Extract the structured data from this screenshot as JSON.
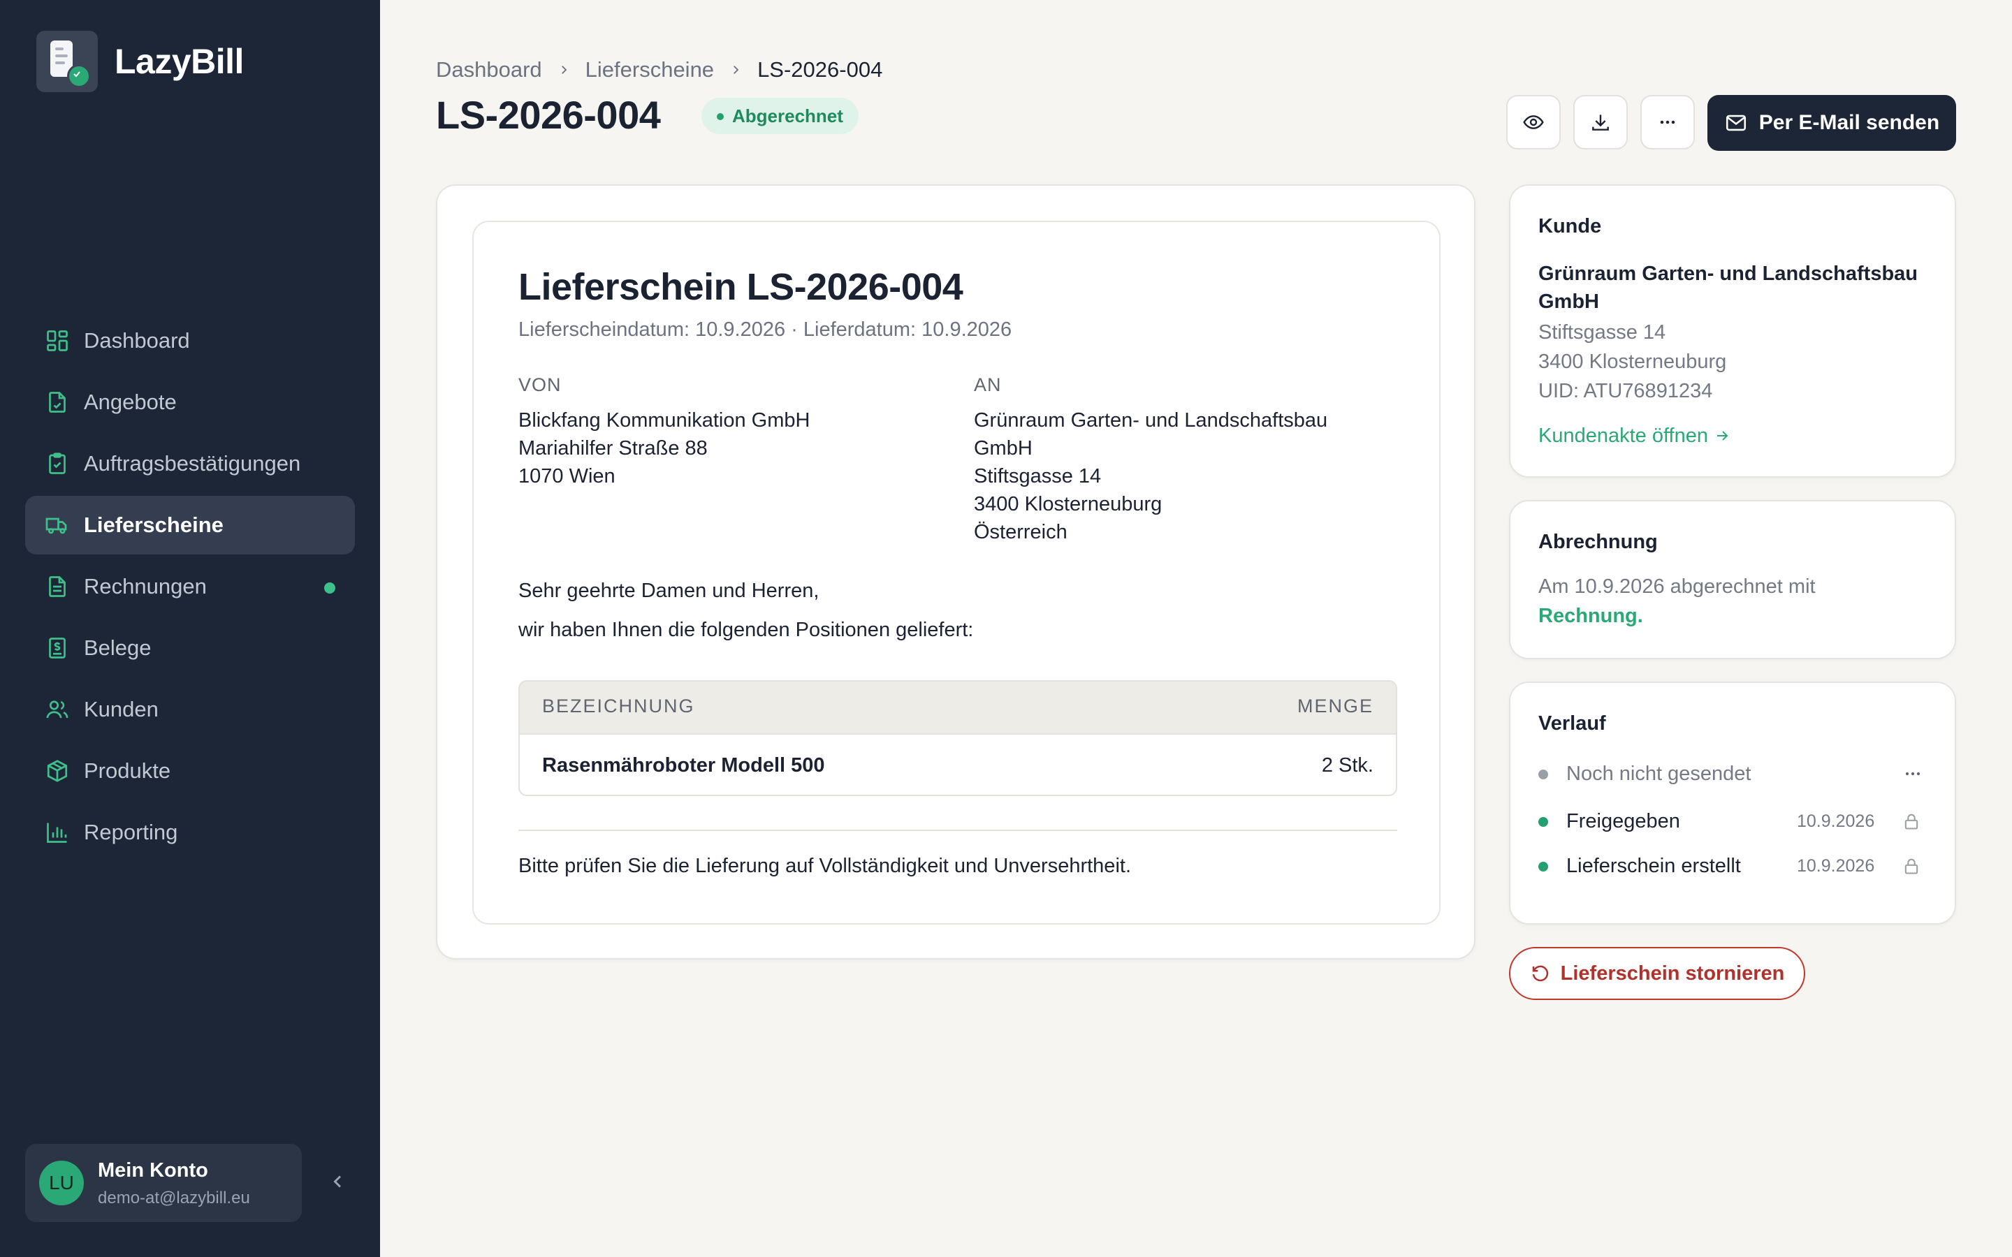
{
  "app": {
    "name": "LazyBill"
  },
  "sidebar": {
    "items": [
      {
        "label": "Dashboard",
        "icon": "dashboard-icon"
      },
      {
        "label": "Angebote",
        "icon": "quote-document-icon"
      },
      {
        "label": "Auftragsbestätigungen",
        "icon": "clipboard-check-icon"
      },
      {
        "label": "Lieferscheine",
        "icon": "truck-icon",
        "active": true
      },
      {
        "label": "Rechnungen",
        "icon": "invoice-icon",
        "badge_color": "#3fbf8a"
      },
      {
        "label": "Belege",
        "icon": "receipt-icon"
      },
      {
        "label": "Kunden",
        "icon": "users-icon"
      },
      {
        "label": "Produkte",
        "icon": "package-icon"
      },
      {
        "label": "Reporting",
        "icon": "bar-chart-icon"
      }
    ],
    "account": {
      "initials": "LU",
      "name": "Mein Konto",
      "email": "demo-at@lazybill.eu"
    }
  },
  "breadcrumb": [
    "Dashboard",
    "Lieferscheine",
    "LS-2026-004"
  ],
  "header": {
    "title": "LS-2026-004",
    "status": "Abgerechnet",
    "send_button": "Per E-Mail senden"
  },
  "document": {
    "title": "Lieferschein LS-2026-004",
    "dates": "Lieferscheindatum: 10.9.2026 · Lieferdatum: 10.9.2026",
    "from_label": "VON",
    "from_lines": [
      "Blickfang Kommunikation GmbH",
      "Mariahilfer Straße 88",
      "1070 Wien"
    ],
    "to_label": "AN",
    "to_lines": [
      "Grünraum Garten- und Landschaftsbau",
      "GmbH",
      "Stiftsgasse 14",
      "3400 Klosterneuburg",
      "Österreich"
    ],
    "greeting": "Sehr geehrte Damen und Herren,",
    "intro": "wir haben Ihnen die folgenden Positionen geliefert:",
    "table": {
      "headers": [
        "BEZEICHNUNG",
        "MENGE"
      ],
      "rows": [
        {
          "name": "Rasenmähroboter Modell 500",
          "qty": "2 Stk."
        }
      ]
    },
    "footnote": "Bitte prüfen Sie die Lieferung auf Vollständigkeit und Unversehrtheit."
  },
  "customer_card": {
    "title": "Kunde",
    "name": "Grünraum Garten- und Landschaftsbau GmbH",
    "street": "Stiftsgasse 14",
    "city": "3400 Klosterneuburg",
    "uid": "UID: ATU76891234",
    "link": "Kundenakte öffnen"
  },
  "billing_card": {
    "title": "Abrechnung",
    "text": "Am 10.9.2026 abgerechnet mit",
    "link": "Rechnung."
  },
  "history_card": {
    "title": "Verlauf",
    "entries": [
      {
        "label": "Noch nicht gesendet",
        "date": "",
        "color": "#9aa0a8"
      },
      {
        "label": "Freigegeben",
        "date": "10.9.2026",
        "color": "#23a06d"
      },
      {
        "label": "Lieferschein erstellt",
        "date": "10.9.2026",
        "color": "#23a06d"
      }
    ]
  },
  "cancel_button": "Lieferschein stornieren",
  "colors": {
    "sidebar": "#1d2636",
    "accent": "#2aa876",
    "danger": "#c0392b",
    "background": "#f6f5f2"
  }
}
